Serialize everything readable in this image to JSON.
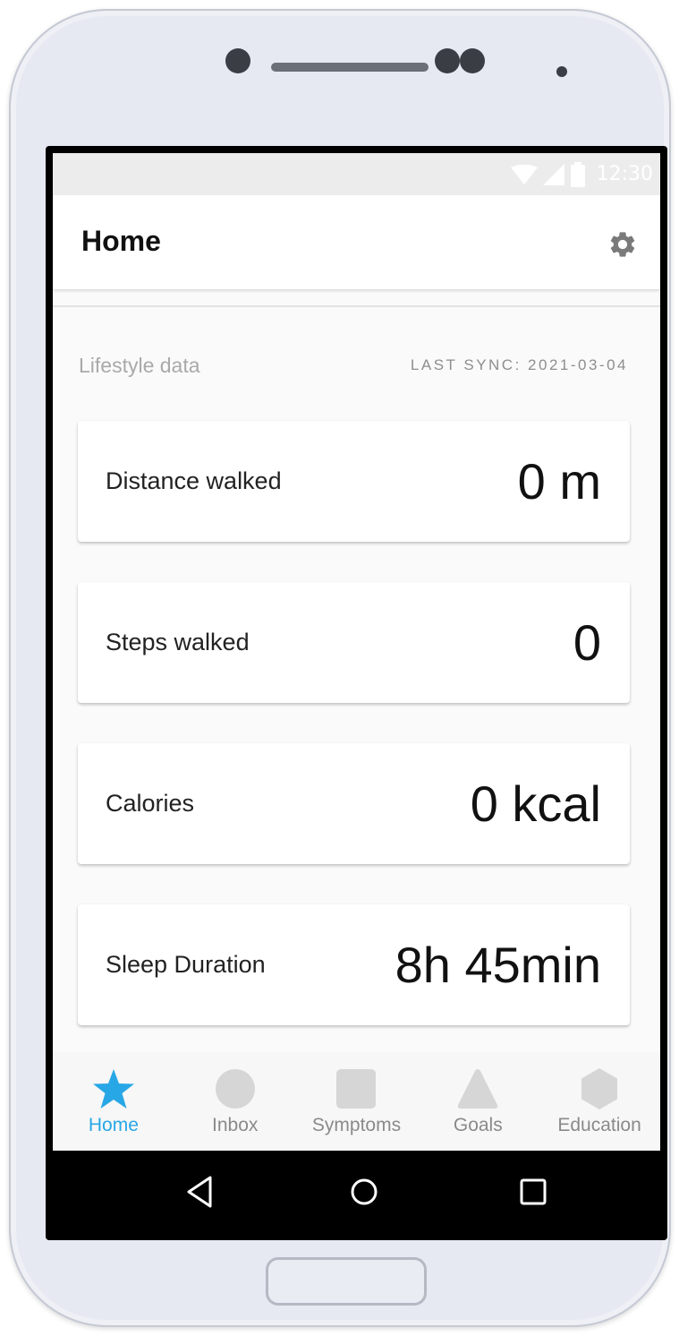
{
  "status_bar": {
    "time": "12:30",
    "icons": [
      "wifi-icon",
      "signal-icon",
      "battery-icon"
    ]
  },
  "header": {
    "title": "Home",
    "settings_icon": "gear-icon"
  },
  "section": {
    "title": "Lifestyle data",
    "last_sync": "LAST SYNC: 2021-03-04"
  },
  "cards": [
    {
      "label": "Distance walked",
      "value": "0 m"
    },
    {
      "label": "Steps walked",
      "value": "0"
    },
    {
      "label": "Calories",
      "value": "0 kcal"
    },
    {
      "label": "Sleep Duration",
      "value": "8h 45min"
    }
  ],
  "tabs": [
    {
      "label": "Home",
      "icon": "star-icon",
      "active": true
    },
    {
      "label": "Inbox",
      "icon": "circle-icon",
      "active": false
    },
    {
      "label": "Symptoms",
      "icon": "square-icon",
      "active": false
    },
    {
      "label": "Goals",
      "icon": "triangle-icon",
      "active": false
    },
    {
      "label": "Education",
      "icon": "hexagon-icon",
      "active": false
    }
  ],
  "nav_bar": [
    "back-icon",
    "home-icon",
    "recents-icon"
  ],
  "colors": {
    "accent": "#28a7e6",
    "inactive_icon": "#d6d6d6",
    "inactive_text": "#8a8a8a"
  }
}
